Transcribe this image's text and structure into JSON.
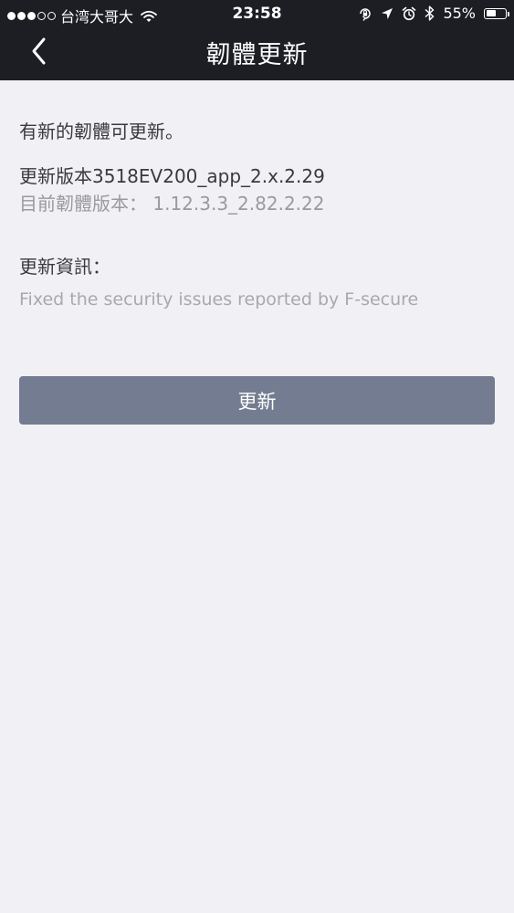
{
  "status_bar": {
    "signal_dots": [
      true,
      true,
      true,
      false,
      false
    ],
    "carrier": "台湾大哥大",
    "time": "23:58",
    "battery_percent": "55%",
    "battery_level": 0.55,
    "icons": [
      "wifi-icon",
      "rotation-lock-icon",
      "location-arrow-icon",
      "alarm-icon",
      "bluetooth-icon",
      "battery-icon"
    ]
  },
  "nav": {
    "title": "韌體更新",
    "back_icon": "chevron-left-icon"
  },
  "content": {
    "notice": "有新的韌體可更新。",
    "new_version": "更新版本3518EV200_app_2.x.2.29",
    "current_version": "目前韌體版本： 1.12.3.3_2.82.2.22",
    "info_label": "更新資訊：",
    "info_text": "Fixed the security issues reported by F-secure"
  },
  "actions": {
    "update_label": "更新"
  },
  "colors": {
    "header_bg": "#1d1e24",
    "page_bg": "#f1f0f5",
    "button_bg": "#737c90",
    "primary_text": "#3a3a3a",
    "secondary_text": "#9a9a9e"
  }
}
